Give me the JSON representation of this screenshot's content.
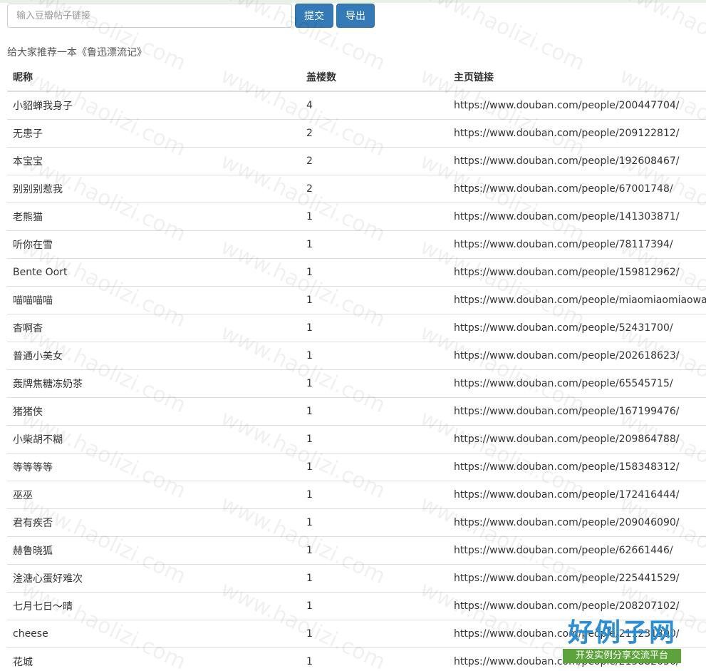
{
  "search": {
    "placeholder": "输入豆瓣帖子链接",
    "value": ""
  },
  "toolbar": {
    "submit_label": "提交",
    "export_label": "导出"
  },
  "post_title": "给大家推荐一本《鲁迅漂流记》",
  "table": {
    "headers": [
      "昵称",
      "盖楼数",
      "主页链接"
    ],
    "rows": [
      {
        "name": "小貂蝉我身子",
        "count": "4",
        "url": "https://www.douban.com/people/200447704/"
      },
      {
        "name": "无患子",
        "count": "2",
        "url": "https://www.douban.com/people/209122812/"
      },
      {
        "name": "本宝宝",
        "count": "2",
        "url": "https://www.douban.com/people/192608467/"
      },
      {
        "name": "别别别惹我",
        "count": "2",
        "url": "https://www.douban.com/people/67001748/"
      },
      {
        "name": "老熊猫",
        "count": "1",
        "url": "https://www.douban.com/people/141303871/"
      },
      {
        "name": "听你在雪",
        "count": "1",
        "url": "https://www.douban.com/people/78117394/"
      },
      {
        "name": "Bente Oort",
        "count": "1",
        "url": "https://www.douban.com/people/159812962/"
      },
      {
        "name": "喵喵喵喵",
        "count": "1",
        "url": "https://www.douban.com/people/miaomiaomiaowa"
      },
      {
        "name": "杳啊杳",
        "count": "1",
        "url": "https://www.douban.com/people/52431700/"
      },
      {
        "name": "普通小美女",
        "count": "1",
        "url": "https://www.douban.com/people/202618623/"
      },
      {
        "name": "轰牌焦糖冻奶茶",
        "count": "1",
        "url": "https://www.douban.com/people/65545715/"
      },
      {
        "name": "猪猪侠",
        "count": "1",
        "url": "https://www.douban.com/people/167199476/"
      },
      {
        "name": "小柴胡不糊",
        "count": "1",
        "url": "https://www.douban.com/people/209864788/"
      },
      {
        "name": "等等等等",
        "count": "1",
        "url": "https://www.douban.com/people/158348312/"
      },
      {
        "name": "巫巫",
        "count": "1",
        "url": "https://www.douban.com/people/172416444/"
      },
      {
        "name": "君有疾否",
        "count": "1",
        "url": "https://www.douban.com/people/209046090/"
      },
      {
        "name": "赫鲁晓狐",
        "count": "1",
        "url": "https://www.douban.com/people/62661446/"
      },
      {
        "name": "淦溏心蛋好难次",
        "count": "1",
        "url": "https://www.douban.com/people/225441529/"
      },
      {
        "name": "七月七日～晴",
        "count": "1",
        "url": "https://www.douban.com/people/208207102/"
      },
      {
        "name": "cheese",
        "count": "1",
        "url": "https://www.douban.com/people/211231300/"
      },
      {
        "name": "花城",
        "count": "1",
        "url": "https://www.douban.com/people/213882636/"
      }
    ]
  },
  "watermark_text": "www.haolizi.com",
  "logo": {
    "main": "好例子网",
    "sub": "开发实例分享交流平台"
  },
  "colors": {
    "primary_button": "#337ab7",
    "logo_blue": "#2a8fd6",
    "logo_green": "#5ba33a"
  }
}
